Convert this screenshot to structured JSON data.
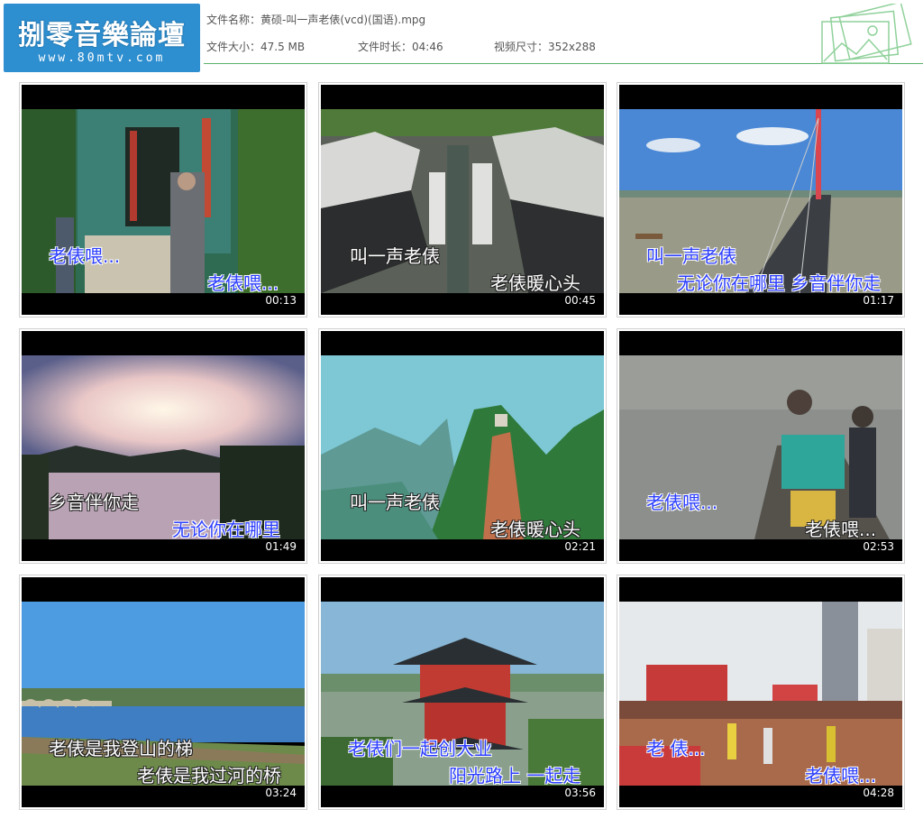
{
  "logo": {
    "title": "捌零音樂論壇",
    "url": "www.80mtv.com"
  },
  "file": {
    "name_label": "文件名称：",
    "name_value": "黄硕-叫一声老俵(vcd)(国语).mpg",
    "size_label": "文件大小：",
    "size_value": "47.5 MB",
    "duration_label": "文件时长：",
    "duration_value": "04:46",
    "dimensions_label": "视频尺寸：",
    "dimensions_value": "352x288"
  },
  "colors": {
    "accent": "#2e8fd0",
    "rule": "#5bb26a",
    "lyric_blue": "#2b3dff",
    "lyric_white": "#ffffff"
  },
  "thumbnails": [
    {
      "timestamp": "00:13",
      "scene": "old-temple-gate",
      "lyric1": "老俵喂...",
      "lyric2": "老俵喂..."
    },
    {
      "timestamp": "00:45",
      "scene": "village-rooftops",
      "lyric1": "叫一声老俵",
      "lyric2": "老俵暖心头"
    },
    {
      "timestamp": "01:17",
      "scene": "bridge-river",
      "lyric1": "叫一声老俵",
      "lyric2": "无论你在哪里 乡音伴你走"
    },
    {
      "timestamp": "01:49",
      "scene": "lake-sunset",
      "lyric1": "乡音伴你走",
      "lyric2": "无论你在哪里"
    },
    {
      "timestamp": "02:21",
      "scene": "green-mountain",
      "lyric1": "叫一声老俵",
      "lyric2": "老俵暖心头"
    },
    {
      "timestamp": "02:53",
      "scene": "boat-people",
      "lyric1": "老俵喂...",
      "lyric2": "老俵喂..."
    },
    {
      "timestamp": "03:24",
      "scene": "arch-bridge-river",
      "lyric1": "老俵是我登山的梯",
      "lyric2": "老俵是我过河的桥"
    },
    {
      "timestamp": "03:56",
      "scene": "pagoda-tower",
      "lyric1": "老俵们一起创大业",
      "lyric2": "阳光路上 一起走"
    },
    {
      "timestamp": "04:28",
      "scene": "marathon-crowd",
      "lyric1": "老 俵...",
      "lyric2": "老俵喂..."
    }
  ]
}
